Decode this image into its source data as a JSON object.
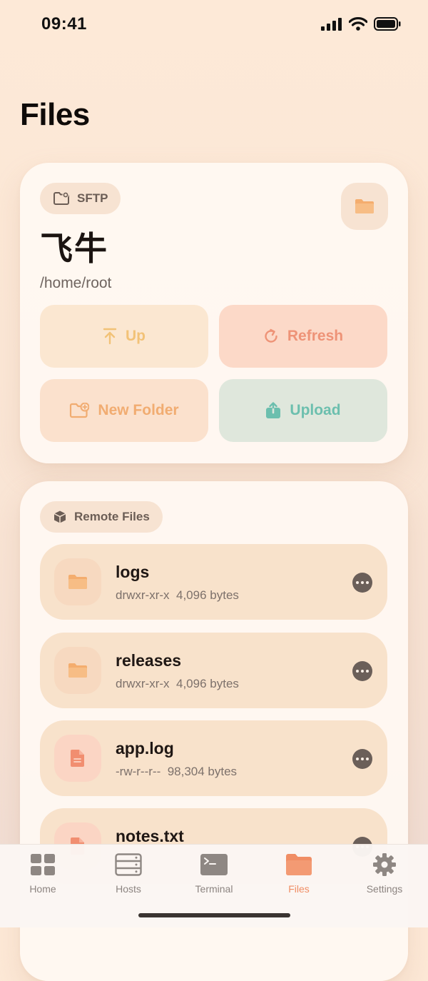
{
  "status_bar": {
    "time": "09:41"
  },
  "page": {
    "title": "Files"
  },
  "server_card": {
    "protocol": "SFTP",
    "name": "飞牛",
    "path": "/home/root",
    "actions": {
      "up": "Up",
      "refresh": "Refresh",
      "new_folder": "New Folder",
      "upload": "Upload"
    }
  },
  "files_card": {
    "section_label": "Remote Files",
    "items": [
      {
        "name": "logs",
        "permissions": "drwxr-xr-x",
        "size": "4,096 bytes",
        "kind": "folder"
      },
      {
        "name": "releases",
        "permissions": "drwxr-xr-x",
        "size": "4,096 bytes",
        "kind": "folder"
      },
      {
        "name": "app.log",
        "permissions": "-rw-r--r--",
        "size": "98,304 bytes",
        "kind": "document"
      },
      {
        "name": "notes.txt",
        "permissions": "",
        "size": "",
        "kind": "document"
      }
    ]
  },
  "tab_bar": {
    "tabs": [
      {
        "label": "Home",
        "icon": "grid-icon"
      },
      {
        "label": "Hosts",
        "icon": "server-rack-icon"
      },
      {
        "label": "Terminal",
        "icon": "terminal-icon"
      },
      {
        "label": "Files",
        "icon": "folder-icon"
      },
      {
        "label": "Settings",
        "icon": "gear-icon"
      }
    ],
    "active": "Files"
  },
  "colors": {
    "accent": "#f08d64",
    "up": "#f2c277",
    "refresh": "#ee9377",
    "new_folder": "#f1ac71",
    "upload": "#6cbfae",
    "folder_icon": "#f4ad6e",
    "document_icon": "#f18e70"
  }
}
